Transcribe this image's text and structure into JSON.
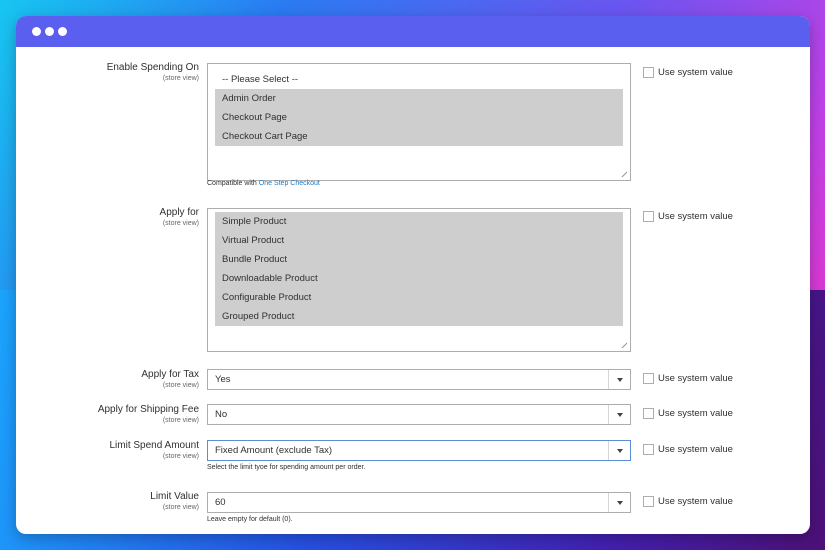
{
  "fields": {
    "enable_spending_on": {
      "label": "Enable Spending On",
      "scope": "(store view)",
      "placeholder_option": "-- Please Select --",
      "options": [
        "Admin Order",
        "Checkout Page",
        "Checkout Cart Page"
      ],
      "note_prefix": "Compatible with",
      "note_link": "One Step Checkout",
      "system_value": "Use system value"
    },
    "apply_for": {
      "label": "Apply for",
      "scope": "(store view)",
      "options": [
        "Simple Product",
        "Virtual Product",
        "Bundle Product",
        "Downloadable Product",
        "Configurable Product",
        "Grouped Product"
      ],
      "system_value": "Use system value"
    },
    "apply_for_tax": {
      "label": "Apply for Tax",
      "scope": "(store view)",
      "value": "Yes",
      "system_value": "Use system value"
    },
    "apply_for_shipping_fee": {
      "label": "Apply for Shipping Fee",
      "scope": "(store view)",
      "value": "No",
      "system_value": "Use system value"
    },
    "limit_spend_amount": {
      "label": "Limit Spend Amount",
      "scope": "(store view)",
      "value": "Fixed Amount (exclude Tax)",
      "note": "Select the limit tyoe for spending amount per order.",
      "system_value": "Use system value"
    },
    "limit_value": {
      "label": "Limit Value",
      "scope": "(store view)",
      "value": "60",
      "note": "Leave empty for default (0).",
      "system_value": "Use system value"
    }
  },
  "colors": {
    "titlebar": "#5b5fef",
    "selected_option": "#cecece",
    "link": "#1979c3"
  }
}
